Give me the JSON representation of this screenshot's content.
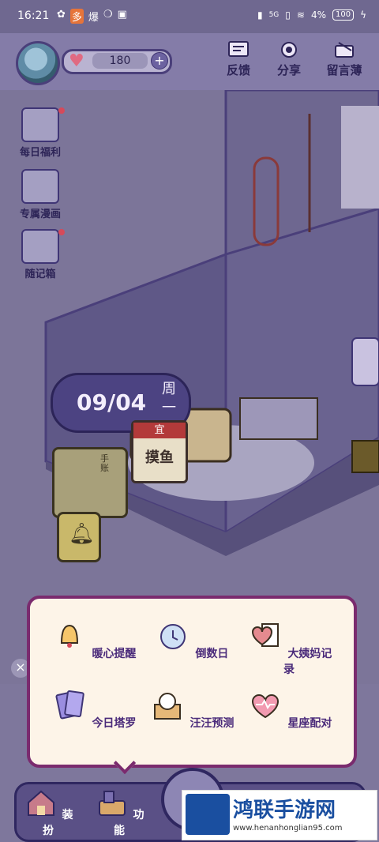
{
  "status_bar": {
    "time": "16:21",
    "apps": [
      "✿",
      "多",
      "爆",
      "❍",
      "▣"
    ],
    "network": "5G",
    "battery_percent": "4%",
    "battery_label": "100"
  },
  "top_bar": {
    "heart_count": "180",
    "buttons": [
      {
        "label": "反馈",
        "icon": "feedback-icon"
      },
      {
        "label": "分享",
        "icon": "share-icon"
      },
      {
        "label": "留言薄",
        "icon": "guestbook-icon"
      }
    ]
  },
  "side_menu": [
    {
      "label": "每日福利",
      "icon": "daily-gift-icon",
      "badge": true
    },
    {
      "label": "专属漫画",
      "icon": "comic-icon",
      "badge": false
    },
    {
      "label": "随记箱",
      "icon": "memo-box-icon",
      "badge": true
    }
  ],
  "room": {
    "date": "09/04",
    "weekday": "周一",
    "calendar_header": "宜",
    "calendar_text": "摸鱼",
    "book_label": "手账"
  },
  "popup": {
    "items": [
      {
        "label": "暖心提醒",
        "icon": "bell-icon"
      },
      {
        "label": "倒数日",
        "icon": "alarm-clock-icon"
      },
      {
        "label": "大姨妈记录",
        "icon": "period-record-icon"
      },
      {
        "label": "今日塔罗",
        "icon": "tarot-icon"
      },
      {
        "label": "汪汪预测",
        "icon": "dog-box-icon"
      },
      {
        "label": "星座配对",
        "icon": "heart-pulse-icon"
      }
    ]
  },
  "bottom_nav": {
    "items": [
      {
        "label": "装扮",
        "icon": "house-icon"
      },
      {
        "label": "功能",
        "icon": "basket-icon"
      }
    ]
  },
  "watermark": {
    "title": "鸿联手游网",
    "url": "www.henanhonglian95.com"
  },
  "colors": {
    "accent": "#4a3f7a",
    "popup_border": "#7a2b6e",
    "badge": "#d64a5a"
  }
}
